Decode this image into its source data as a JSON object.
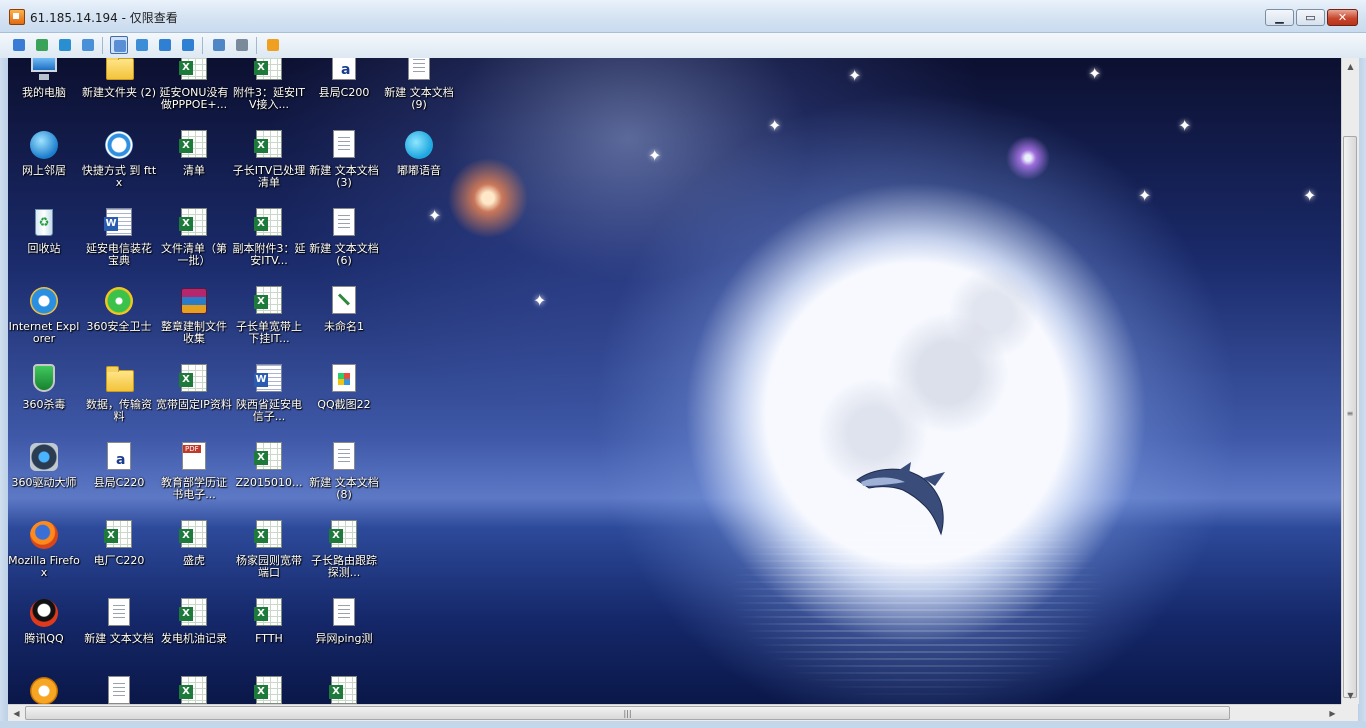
{
  "window": {
    "title": "61.185.14.194 - 仅限查看",
    "minimize_icon": "minimize-icon",
    "maximize_icon": "restore-icon",
    "close_icon": "close-icon"
  },
  "toolbar": {
    "buttons": [
      {
        "name": "send-ctrl-alt-del-icon",
        "color": "#3a7bd5"
      },
      {
        "name": "transfer-icon",
        "color": "#3aa35a"
      },
      {
        "name": "phone-icon",
        "color": "#2a8fd0"
      },
      {
        "name": "chat-icon",
        "color": "#4a90d9"
      },
      {
        "name": "normal-view-icon",
        "color": "#5a8fd6",
        "selected": true
      },
      {
        "name": "scale-view-icon",
        "color": "#3c8dd8"
      },
      {
        "name": "fullscreen-icon",
        "color": "#2f7fd2"
      },
      {
        "name": "fit-window-icon",
        "color": "#2f7fd2"
      },
      {
        "name": "screenshot-icon",
        "color": "#4f86c6"
      },
      {
        "name": "tools-icon",
        "color": "#7a8a9a"
      },
      {
        "name": "disconnect-icon",
        "color": "#f0a020"
      }
    ]
  },
  "desktop": {
    "icons": [
      {
        "label": "我的电脑",
        "type": "pc"
      },
      {
        "label": "新建文件夹 (2)",
        "type": "folder"
      },
      {
        "label": "延安ONU没有做PPPOE+...",
        "type": "xls"
      },
      {
        "label": "附件3：延安ITV接入...",
        "type": "xls"
      },
      {
        "label": "县局C200",
        "type": "doca"
      },
      {
        "label": "新建 文本文档 (9)",
        "type": "doc"
      },
      {
        "label": "网上邻居",
        "type": "network"
      },
      {
        "label": "快捷方式 到 fttx",
        "type": "shortcut"
      },
      {
        "label": "清单",
        "type": "xls"
      },
      {
        "label": "子长ITV已处理清单",
        "type": "xls"
      },
      {
        "label": "新建 文本文档 (3)",
        "type": "doc"
      },
      {
        "label": "嘟嘟语音",
        "type": "dudu"
      },
      {
        "label": "回收站",
        "type": "recycle"
      },
      {
        "label": "延安电信装花宝典",
        "type": "word"
      },
      {
        "label": "文件清单（第一批）",
        "type": "xls"
      },
      {
        "label": "副本附件3：延安ITV...",
        "type": "xls"
      },
      {
        "label": "新建 文本文档 (6)",
        "type": "doc"
      },
      {
        "label": "Internet Explorer",
        "type": "ie"
      },
      {
        "label": "360安全卫士",
        "type": "guard360"
      },
      {
        "label": "整章建制文件收集",
        "type": "rar"
      },
      {
        "label": "子长单宽带上下挂IT...",
        "type": "xls"
      },
      {
        "label": "未命名1",
        "type": "paint"
      },
      {
        "label": "360杀毒",
        "type": "shield"
      },
      {
        "label": "数据，传输资料",
        "type": "folder"
      },
      {
        "label": "宽带固定IP资料",
        "type": "xls"
      },
      {
        "label": "陕西省延安电信子...",
        "type": "word"
      },
      {
        "label": "QQ截图22",
        "type": "png"
      },
      {
        "label": "360驱动大师",
        "type": "driver360"
      },
      {
        "label": "县局C220",
        "type": "doca"
      },
      {
        "label": "教育部学历证书电子...",
        "type": "pdf"
      },
      {
        "label": "Z2015010...",
        "type": "xls"
      },
      {
        "label": "新建 文本文档 (8)",
        "type": "doc"
      },
      {
        "label": "Mozilla Firefox",
        "type": "firefox"
      },
      {
        "label": "电厂C220",
        "type": "xls"
      },
      {
        "label": "盛虎",
        "type": "xls"
      },
      {
        "label": "杨家园则宽带端口",
        "type": "xls"
      },
      {
        "label": "子长路由跟踪探测...",
        "type": "xls"
      },
      {
        "label": "腾讯QQ",
        "type": "qq"
      },
      {
        "label": "新建 文本文档",
        "type": "doc"
      },
      {
        "label": "发电机油记录",
        "type": "xls"
      },
      {
        "label": "FTTH",
        "type": "xls"
      },
      {
        "label": "异网ping测",
        "type": "doc"
      },
      {
        "label": "",
        "type": "mail"
      },
      {
        "label": "",
        "type": "doc"
      },
      {
        "label": "",
        "type": "xls"
      },
      {
        "label": "",
        "type": "xls"
      },
      {
        "label": "",
        "type": "xls"
      }
    ]
  },
  "scrollbars": {
    "vertical_up": "▲",
    "vertical_down": "▼",
    "horizontal_left": "◀",
    "horizontal_right": "▶",
    "grip": "|||",
    "vertical_grip": "≡"
  }
}
